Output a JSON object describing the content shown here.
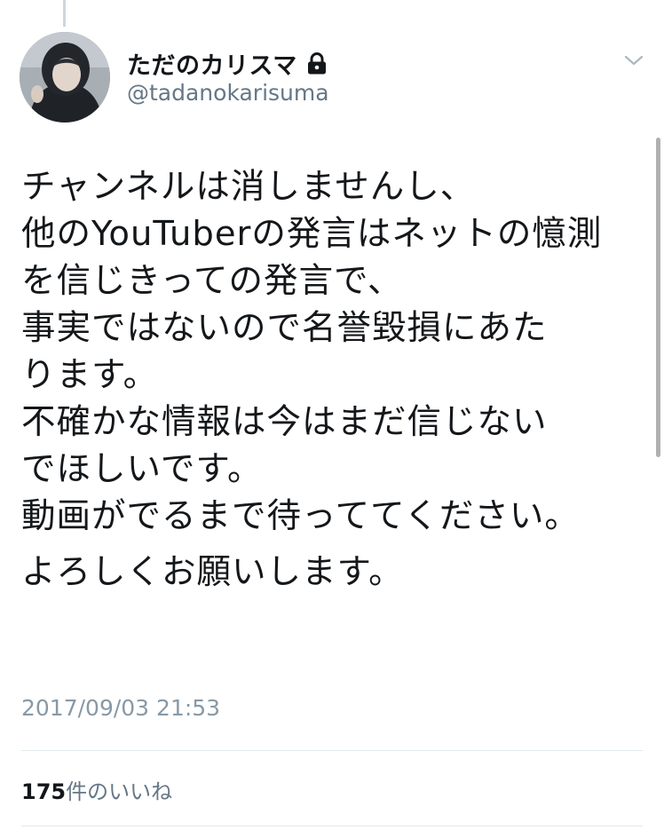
{
  "author": {
    "display_name": "ただのカリスマ",
    "handle": "@tadanokarisuma",
    "protected_icon": "lock-icon",
    "avatar": "avatar"
  },
  "menu_icon": "chevron-down-icon",
  "tweet": {
    "lines": [
      "チャンネルは消しませんし、",
      "他のYouTuberの発言はネットの憶測",
      "を信じきっての発言で、",
      "事実ではないので名誉毀損にあた",
      "ります。",
      "不確かな情報は今はまだ信じない",
      "でほしいです。",
      "動画がでるまで待っててください。",
      "よろしくお願いします。"
    ],
    "timestamp": "2017/09/03 21:53"
  },
  "stats": {
    "likes_count": "175",
    "likes_label": "件のいいね"
  },
  "colors": {
    "text": "#14171a",
    "secondary": "#657786",
    "timestamp": "#8899a6",
    "divider": "#e1e8ed"
  }
}
